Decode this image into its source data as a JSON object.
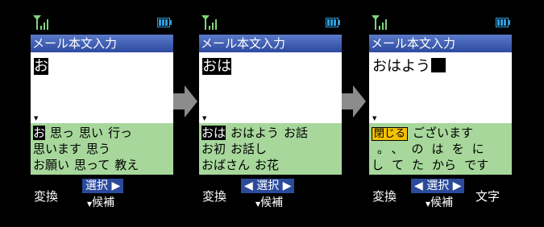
{
  "common": {
    "title": "メール本文入力",
    "caret": "▼",
    "softkey_left": "変換",
    "softkey_center": "選択",
    "softkey_sub": "候補",
    "left_arrow": "◀",
    "right_arrow": "▶",
    "sub_arrow": "▼"
  },
  "screens": [
    {
      "composing": "お",
      "committed": "",
      "candidates": {
        "row1": [
          "お",
          "思っ",
          "思い",
          "行っ"
        ],
        "row2": [
          "思います",
          "思う"
        ],
        "row3": [
          "お願い",
          "思って",
          "教え"
        ]
      }
    },
    {
      "composing": "おは",
      "committed": "",
      "candidates": {
        "row1": [
          "おは",
          "おはよう",
          "お話"
        ],
        "row2": [
          "お初",
          "お話し"
        ],
        "row3": [
          "おばさん",
          "お花"
        ]
      }
    },
    {
      "composing": "",
      "committed": "おはよう",
      "close_label": "閉じる",
      "candidates": {
        "row1": [
          "ございます"
        ],
        "row2": [
          "。",
          "、",
          "の",
          "は",
          "を",
          "に"
        ],
        "row3": [
          "し",
          "て",
          "た",
          "から",
          "です"
        ]
      },
      "softkey_right": "文字"
    }
  ]
}
